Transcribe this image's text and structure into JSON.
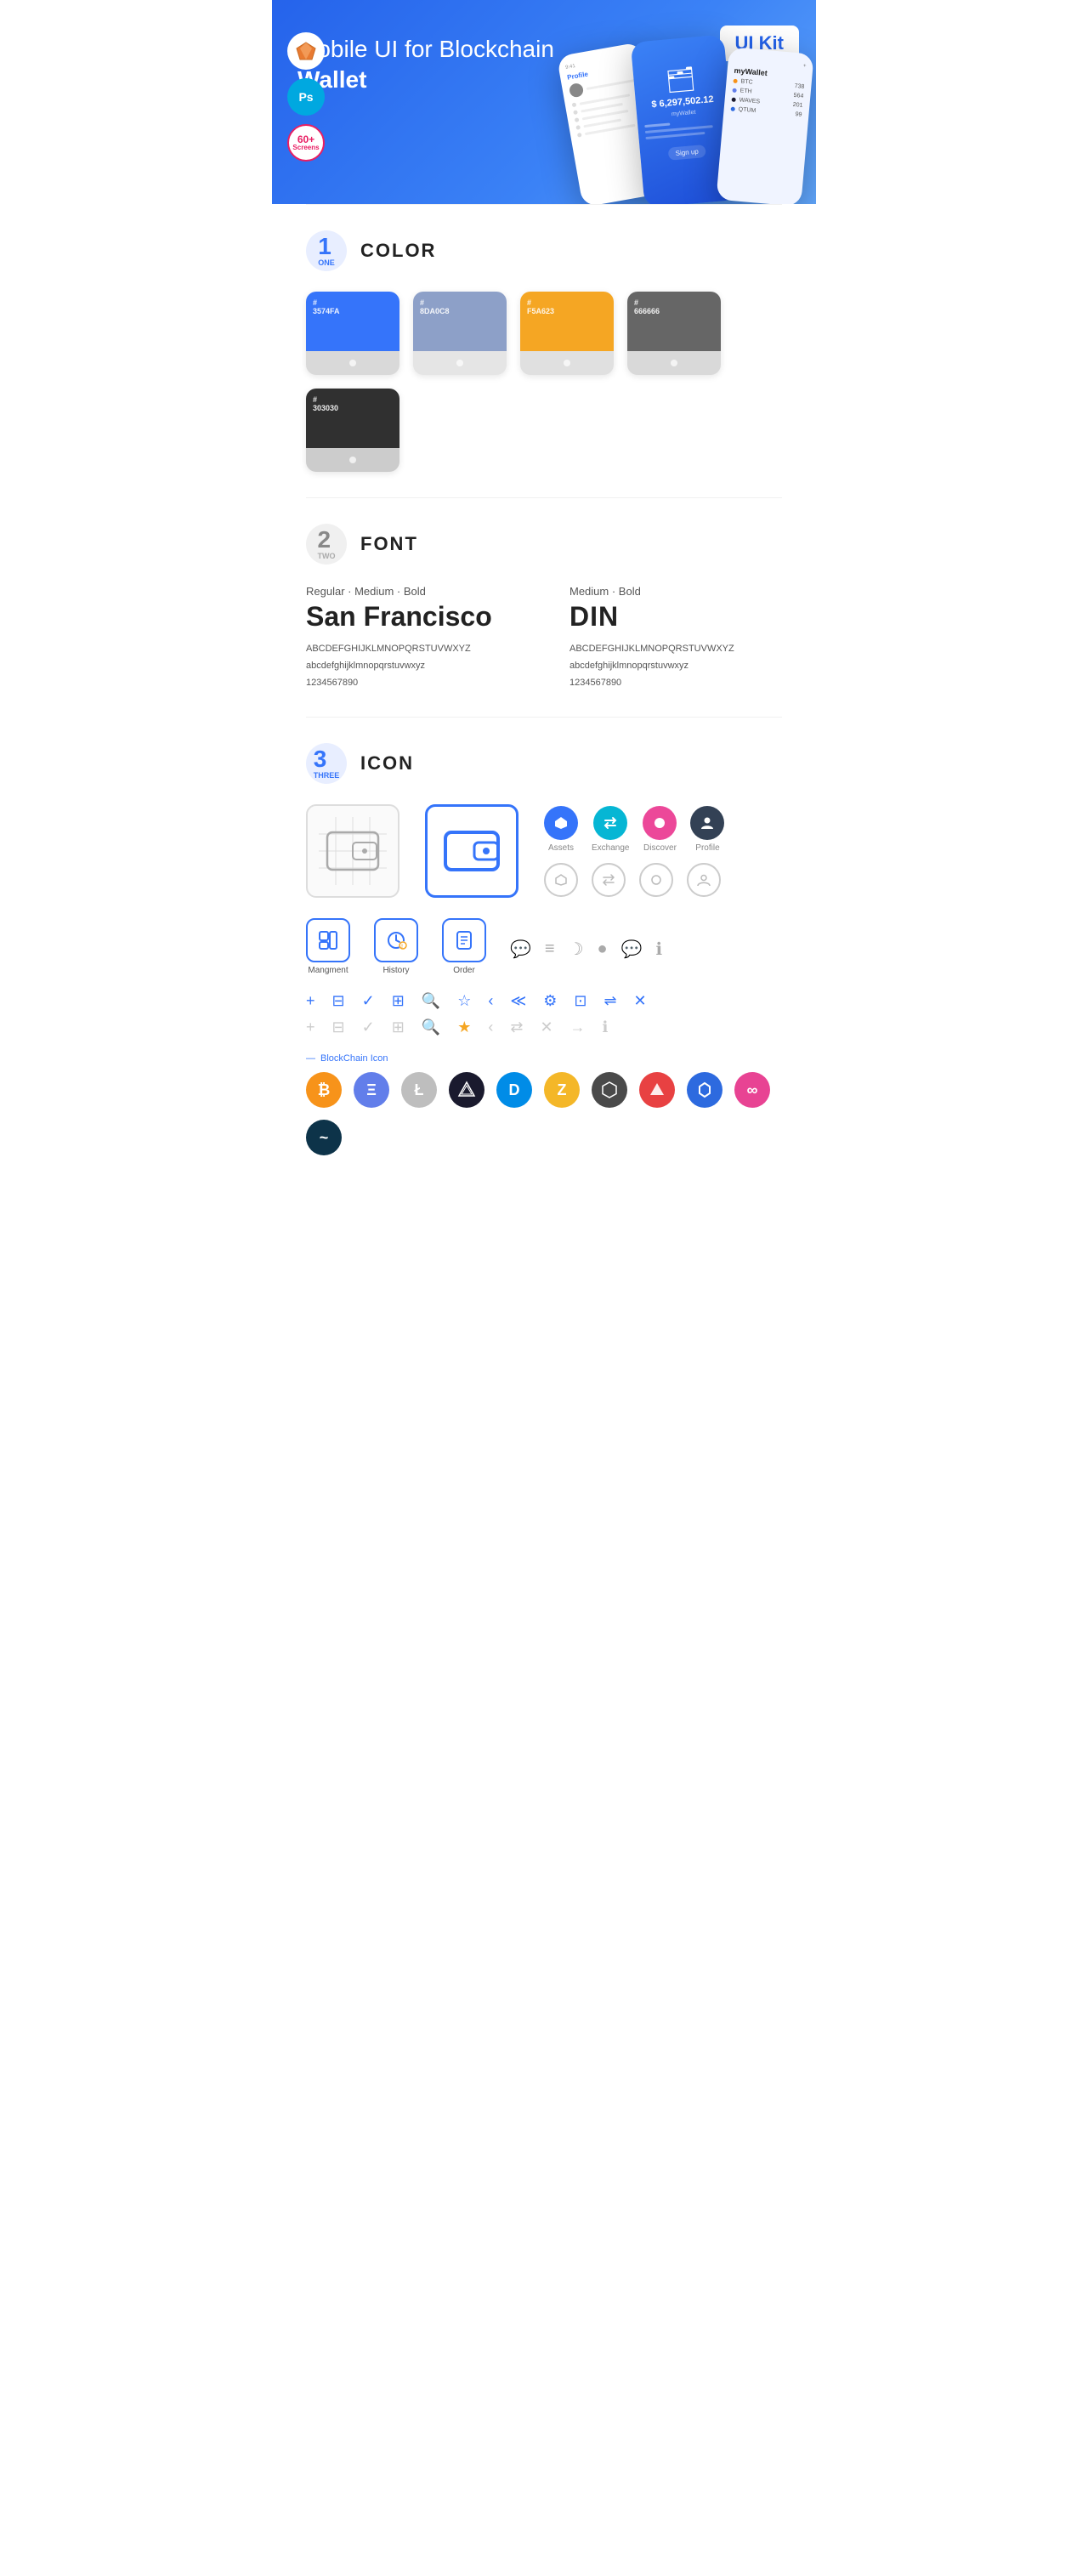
{
  "hero": {
    "title_regular": "Mobile UI for Blockchain ",
    "title_bold": "Wallet",
    "badge": "UI Kit",
    "tools": [
      {
        "name": "Sketch",
        "symbol": "✦",
        "bg": "#fff",
        "color": "#e87a31"
      },
      {
        "name": "Photoshop",
        "symbol": "Ps",
        "bg": "#00a8e0",
        "color": "#fff"
      },
      {
        "name": "Screens",
        "text": "60+\nScreens",
        "bg": "#fff",
        "border": "#f05",
        "color": "#f05"
      }
    ]
  },
  "sections": {
    "color": {
      "num": "1",
      "sub": "ONE",
      "title": "COLOR",
      "swatches": [
        {
          "hex": "#3574FA",
          "label": "#\n3574FA",
          "color": "#3574FA"
        },
        {
          "hex": "#8DA0C8",
          "label": "#\n8DA0C8",
          "color": "#8DA0C8"
        },
        {
          "hex": "#F5A623",
          "label": "#\nF5A623",
          "color": "#F5A623"
        },
        {
          "hex": "#666666",
          "label": "#\n666666",
          "color": "#666666"
        },
        {
          "hex": "#303030",
          "label": "#\n303030",
          "color": "#303030"
        }
      ]
    },
    "font": {
      "num": "2",
      "sub": "TWO",
      "title": "FONT",
      "fonts": [
        {
          "style": "Regular · Medium · Bold",
          "name": "San Francisco",
          "is_bold": true,
          "uppercase": "ABCDEFGHIJKLMNOPQRSTUVWXYZ",
          "lowercase": "abcdefghijklmnopqrstuvwxyz",
          "numbers": "1234567890"
        },
        {
          "style": "Medium · Bold",
          "name": "DIN",
          "is_bold": false,
          "uppercase": "ABCDEFGHIJKLMNOPQRSTUVWXYZ",
          "lowercase": "abcdefghijklmnopqrstuvwxyz",
          "numbers": "1234567890"
        }
      ]
    },
    "icon": {
      "num": "3",
      "sub": "THREE",
      "title": "ICON",
      "main_icons": [
        {
          "label": "",
          "type": "outline-wallet"
        },
        {
          "label": "",
          "type": "blue-wallet"
        }
      ],
      "nav_icons": [
        {
          "label": "Assets",
          "type": "circle-blue",
          "symbol": "◆"
        },
        {
          "label": "Exchange",
          "type": "circle-teal",
          "symbol": "♻"
        },
        {
          "label": "Discover",
          "type": "circle-pink",
          "symbol": "⬤"
        },
        {
          "label": "Profile",
          "type": "circle-dark",
          "symbol": "👤"
        }
      ],
      "nav_icons_outline": [
        {
          "type": "outline",
          "symbol": "◆"
        },
        {
          "type": "outline",
          "symbol": "♻"
        },
        {
          "type": "outline",
          "symbol": "⬤"
        },
        {
          "type": "outline",
          "symbol": "👤"
        }
      ],
      "tab_icons": [
        {
          "label": "Mangment",
          "symbol": "▣"
        },
        {
          "label": "History",
          "symbol": "🕐"
        },
        {
          "label": "Order",
          "symbol": "📋"
        }
      ],
      "misc_icons_row1": [
        "💬",
        "≡",
        "☽",
        "⬤",
        "💬",
        "ℹ"
      ],
      "tool_icons": [
        "+",
        "⊟",
        "✓",
        "⊞",
        "🔍",
        "☆",
        "‹",
        "≪",
        "⚙",
        "⊡",
        "⇌",
        "✕"
      ],
      "tool_icons_faded": [
        "+",
        "⊟",
        "✓",
        "⊞",
        "🔍",
        "☆",
        "‹",
        "≪",
        "✕",
        "→",
        "ℹ"
      ],
      "blockchain_label": "BlockChain Icon",
      "crypto": [
        {
          "symbol": "₿",
          "bg": "#f7931a",
          "name": "Bitcoin"
        },
        {
          "symbol": "Ξ",
          "bg": "#627eea",
          "name": "Ethereum"
        },
        {
          "symbol": "Ł",
          "bg": "#bfbbbb",
          "name": "Litecoin"
        },
        {
          "symbol": "◆",
          "bg": "#1a1a2e",
          "name": "Nimiq"
        },
        {
          "symbol": "D",
          "bg": "#008ce7",
          "name": "Dash"
        },
        {
          "symbol": "Z",
          "bg": "#f4b728",
          "name": "Zcash"
        },
        {
          "symbol": "⬡",
          "bg": "#5b5b5b",
          "name": "IOTA"
        },
        {
          "symbol": "▲",
          "bg": "#e84142",
          "name": "Avalanche"
        },
        {
          "symbol": "◇",
          "bg": "#2d6adf",
          "name": "Chainlink"
        },
        {
          "symbol": "∞",
          "bg": "#e84393",
          "name": "Polkadot"
        },
        {
          "symbol": "~",
          "bg": "#0d3349",
          "name": "Stellar"
        }
      ]
    }
  }
}
